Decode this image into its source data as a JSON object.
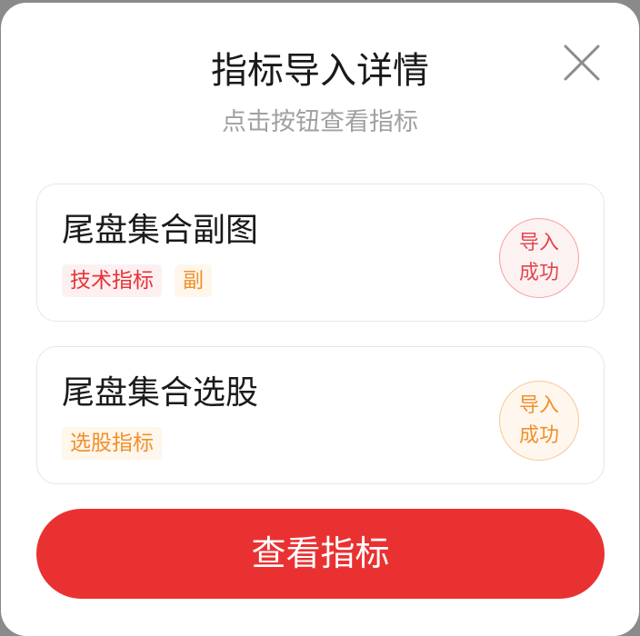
{
  "dialog": {
    "title": "指标导入详情",
    "subtitle": "点击按钮查看指标",
    "close_icon": "close-icon"
  },
  "indicators": [
    {
      "name": "尾盘集合副图",
      "tags": [
        "技术指标",
        "副"
      ],
      "status": [
        "导入",
        "成功"
      ],
      "accent": "#e63238"
    },
    {
      "name": "尾盘集合选股",
      "tags": [
        "选股指标"
      ],
      "status": [
        "导入",
        "成功"
      ],
      "accent": "#f0902b"
    }
  ],
  "actions": {
    "view_label": "查看指标"
  },
  "colors": {
    "primary": "#ea3132",
    "tag_red": "#e63238",
    "tag_orange": "#f0902b",
    "subtitle": "#a0a0a0"
  }
}
